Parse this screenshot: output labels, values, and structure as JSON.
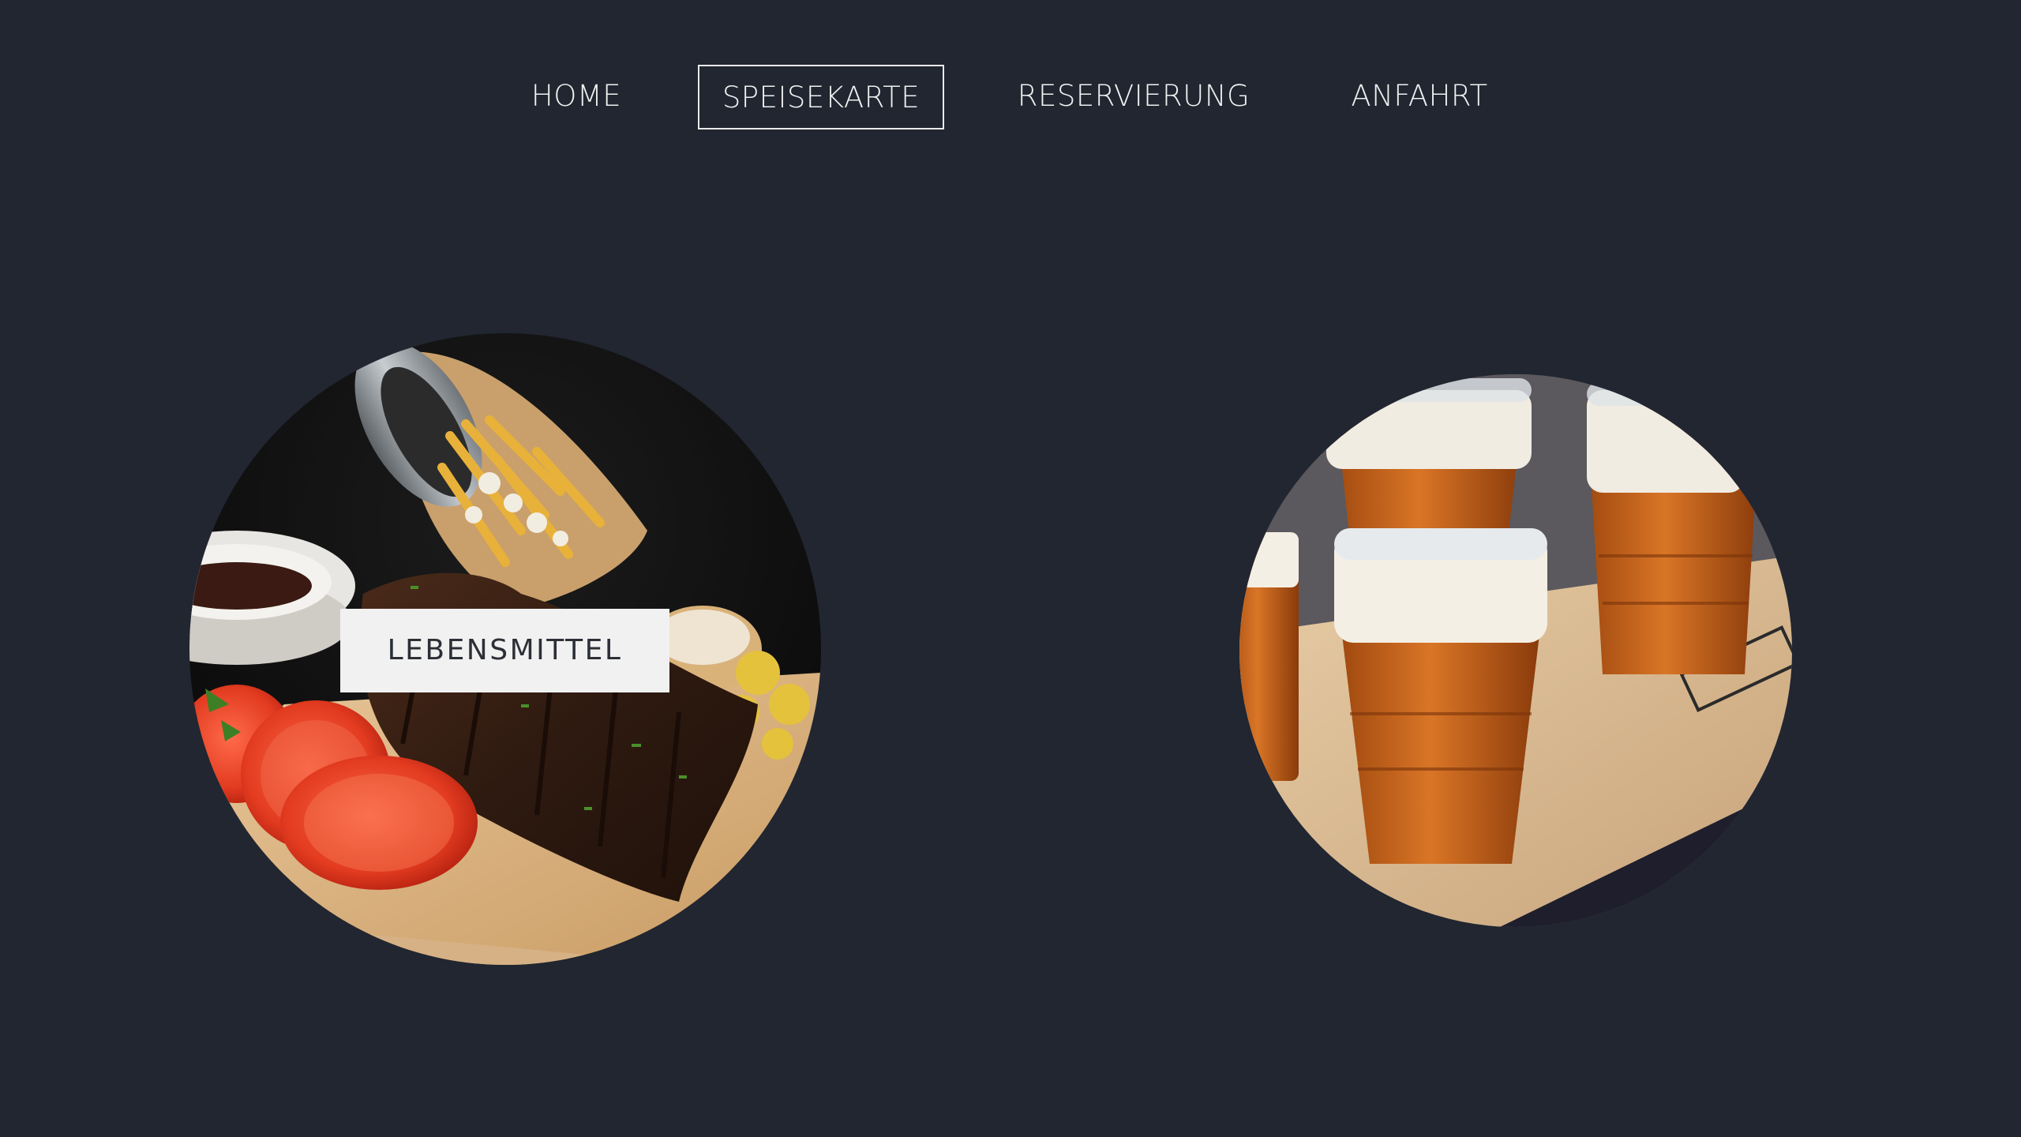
{
  "nav": {
    "items": [
      {
        "label": "HOME"
      },
      {
        "label": "SPEISEKARTE",
        "active": true
      },
      {
        "label": "RESERVIERUNG"
      },
      {
        "label": "ANFAHRT"
      }
    ]
  },
  "categories": [
    {
      "label": "LEBENSMITTEL",
      "image": "food-platter-image"
    },
    {
      "image": "beer-glasses-image"
    }
  ],
  "colors": {
    "background": "#212631",
    "nav_text": "#f1f1f1",
    "label_bg": "#f1f1f1",
    "label_text": "#2c2f36"
  }
}
